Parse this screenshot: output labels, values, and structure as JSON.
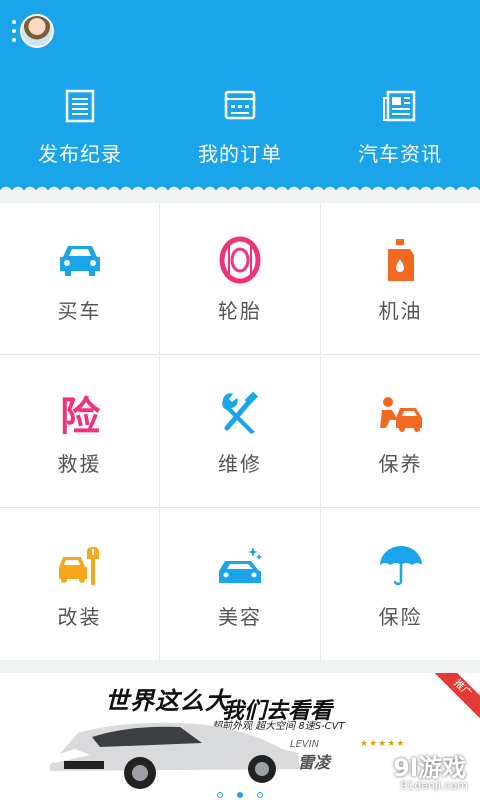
{
  "header": {
    "avatar_alt": "avatar",
    "quick_links": [
      {
        "label": "发布纪录",
        "icon": "list-document-icon"
      },
      {
        "label": "我的订单",
        "icon": "order-window-icon"
      },
      {
        "label": "汽车资讯",
        "icon": "newspaper-icon"
      }
    ]
  },
  "services": [
    {
      "label": "买车",
      "icon": "car-icon",
      "color": "#1aa5ea"
    },
    {
      "label": "轮胎",
      "icon": "tire-icon",
      "color": "#f0317c"
    },
    {
      "label": "机油",
      "icon": "oil-bottle-icon",
      "color": "#f26a21"
    },
    {
      "label": "救援",
      "icon": "rescue-icon",
      "color": "#f0317c"
    },
    {
      "label": "维修",
      "icon": "wrench-screwdriver-icon",
      "color": "#1aa5ea"
    },
    {
      "label": "保养",
      "icon": "car-maintenance-icon",
      "color": "#f26a21"
    },
    {
      "label": "改装",
      "icon": "car-modify-icon",
      "color": "#f6a81a"
    },
    {
      "label": "美容",
      "icon": "car-sparkle-icon",
      "color": "#1aa5ea"
    },
    {
      "label": "保险",
      "icon": "umbrella-icon",
      "color": "#1aa5ea"
    }
  ],
  "banner": {
    "slogan_1": "世界这么大",
    "slogan_2": "我们去看看",
    "subtext": "超前外观  超大空间  8速S-CVT",
    "badge": "推广",
    "model": "LEVIN",
    "model_cn": "雷凌",
    "stars": "★★★★★",
    "active_page": 2,
    "page_count": 3
  },
  "watermark": {
    "main": "9l游戏",
    "sub": "91danji.com"
  },
  "colors": {
    "primary": "#1aa5ea",
    "pink": "#f0317c",
    "orange": "#f26a21",
    "yellow": "#f6a81a"
  }
}
